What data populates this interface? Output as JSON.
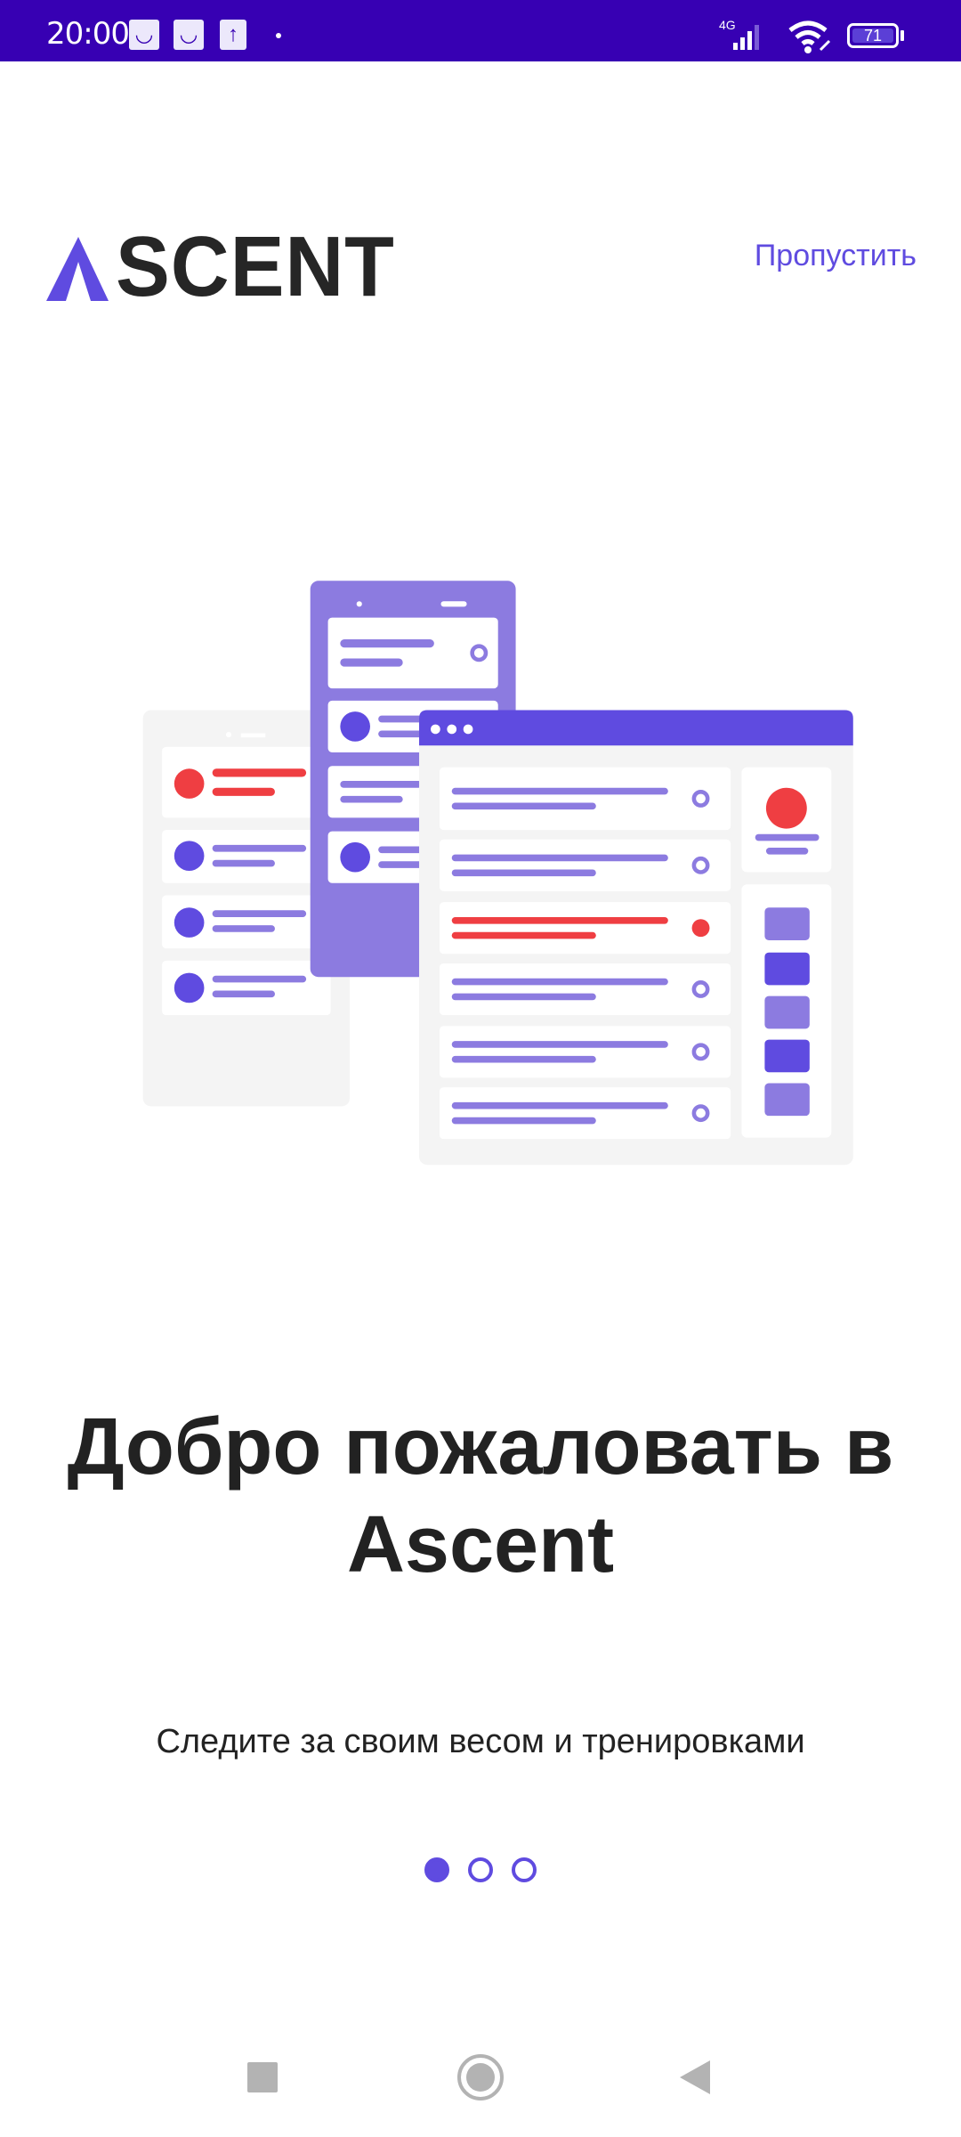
{
  "status_bar": {
    "time": "20:00",
    "network": "4G",
    "battery": "71",
    "notification_icons": [
      "shop-bag-icon",
      "shop-bag-icon",
      "upload-icon"
    ]
  },
  "header": {
    "logo_text": "SCENT",
    "logo_full": "ASCENT",
    "skip_label": "Пропустить"
  },
  "onboarding": {
    "title": "Добро пожаловать в Ascent",
    "subtitle": "Следите за своим весом и тренировками",
    "page_indicator": {
      "current": 1,
      "total": 3
    }
  },
  "colors": {
    "primary": "#5f4be0",
    "primary_light": "#8c7be0",
    "accent_red": "#ef3e42",
    "status_bar": "#3700b3"
  }
}
